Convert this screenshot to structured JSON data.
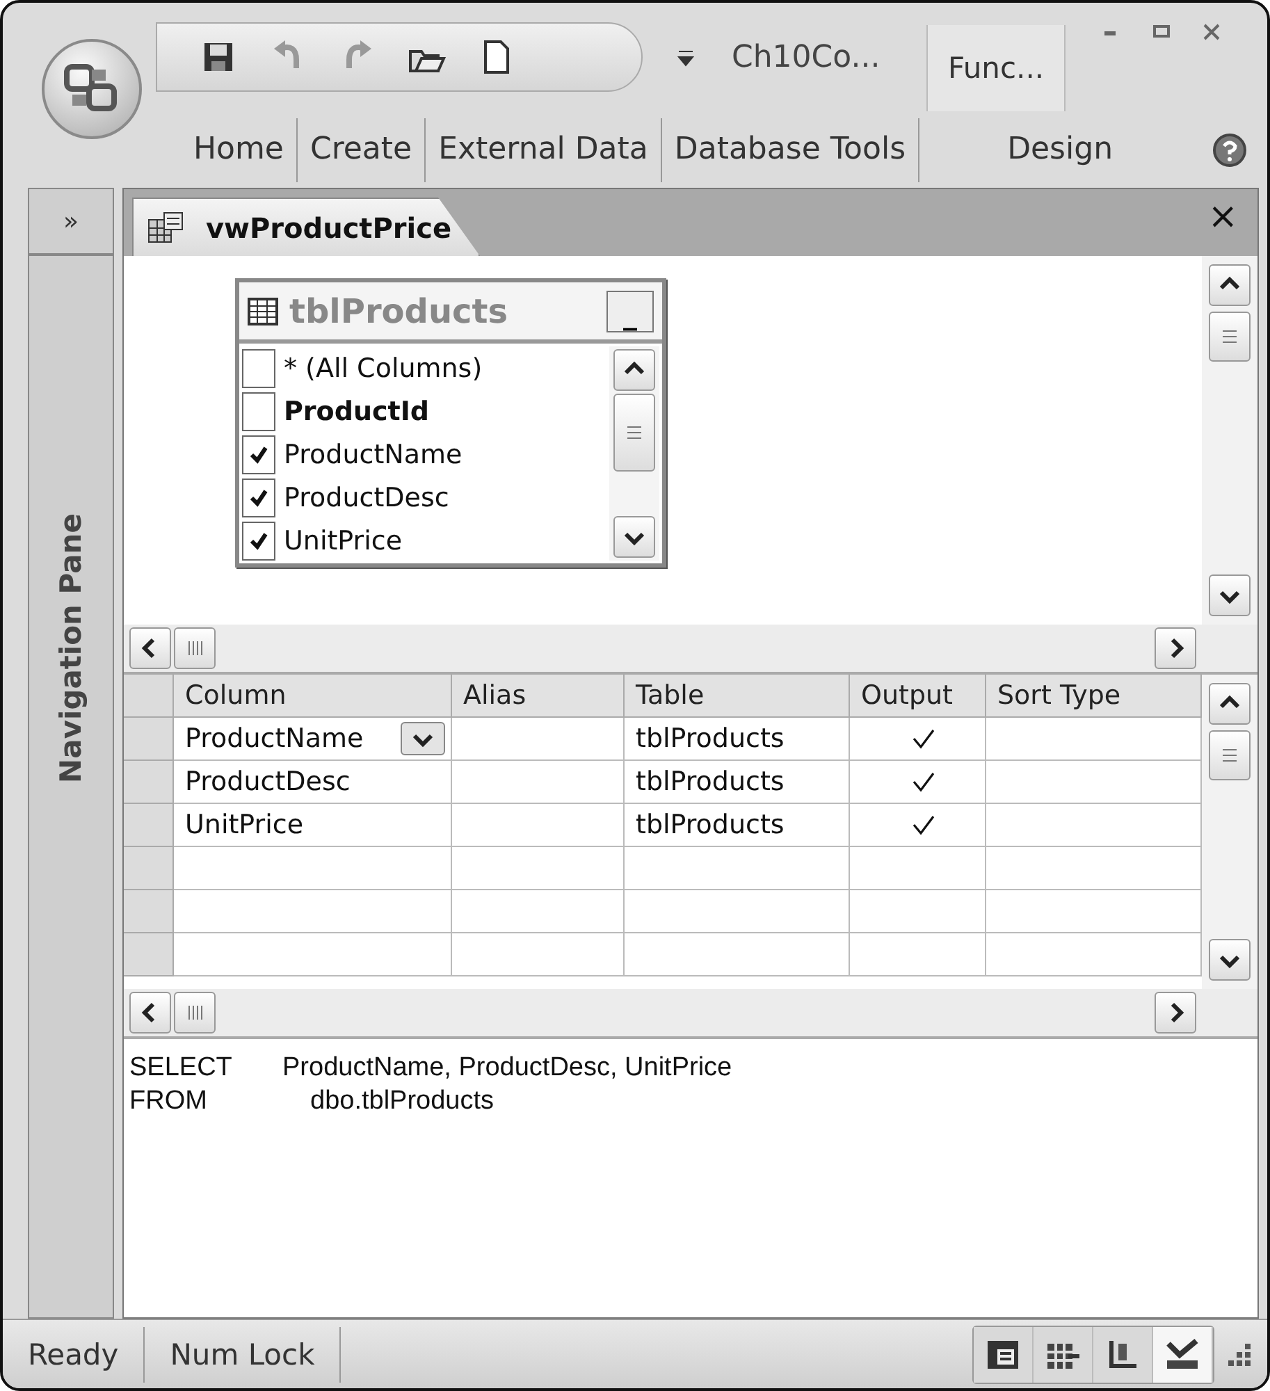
{
  "title": "Ch10Co...",
  "context_tab": "Func...",
  "ribbon_tabs": [
    "Home",
    "Create",
    "External Data",
    "Database Tools",
    "Design"
  ],
  "navigation_pane": {
    "toggle": "»",
    "label": "Navigation Pane"
  },
  "document_tab": {
    "title": "vwProductPrice",
    "close": "×"
  },
  "table_box": {
    "title": "tblProducts",
    "minimize": "_",
    "fields": [
      {
        "name": "* (All Columns)",
        "checked": false,
        "primary_key": false
      },
      {
        "name": "ProductId",
        "checked": false,
        "primary_key": true
      },
      {
        "name": "ProductName",
        "checked": true,
        "primary_key": false
      },
      {
        "name": "ProductDesc",
        "checked": true,
        "primary_key": false
      },
      {
        "name": "UnitPrice",
        "checked": true,
        "primary_key": false
      }
    ]
  },
  "grid": {
    "columns": [
      "Column",
      "Alias",
      "Table",
      "Output",
      "Sort Type"
    ],
    "rows": [
      {
        "column": "ProductName",
        "table": "tblProducts",
        "output": true,
        "dropdown": true
      },
      {
        "column": "ProductDesc",
        "table": "tblProducts",
        "output": true,
        "dropdown": false
      },
      {
        "column": "UnitPrice",
        "table": "tblProducts",
        "output": true,
        "dropdown": false
      },
      {
        "output": false,
        "dropdown": false
      },
      {
        "output": false,
        "dropdown": false
      },
      {
        "output": false,
        "dropdown": false
      }
    ]
  },
  "sql": [
    {
      "keyword": "SELECT",
      "text": "ProductName, ProductDesc, UnitPrice",
      "indent": false
    },
    {
      "keyword": "FROM",
      "text": "dbo.tblProducts",
      "indent": true
    }
  ],
  "status_bar": {
    "texts": [
      "Ready",
      "Num Lock"
    ],
    "views": [
      {
        "selected": false
      },
      {
        "selected": false
      },
      {
        "selected": false
      },
      {
        "selected": true
      }
    ]
  }
}
